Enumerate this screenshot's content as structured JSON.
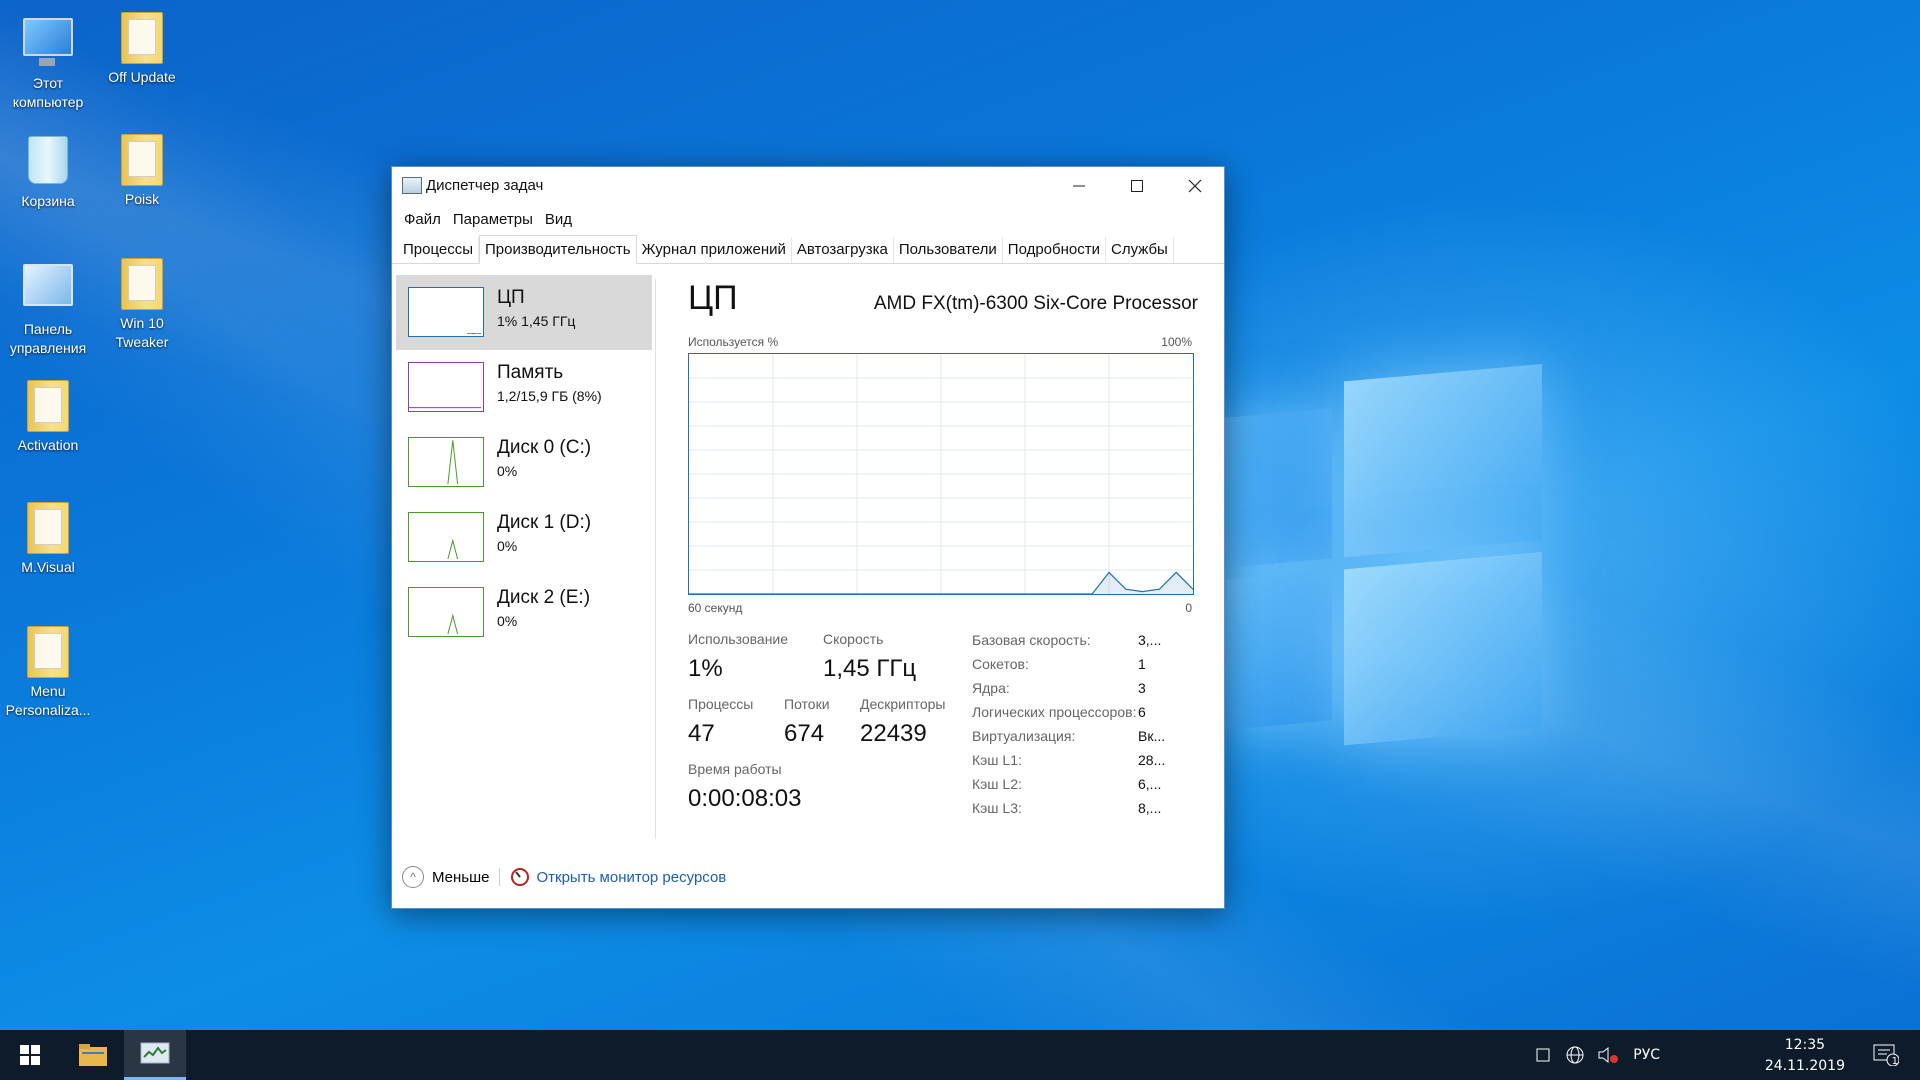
{
  "desktop": {
    "icons": [
      {
        "label": "Этот компьютер"
      },
      {
        "label": "Off Update"
      },
      {
        "label": "Корзина"
      },
      {
        "label": "Poisk"
      },
      {
        "label": "Панель управления"
      },
      {
        "label": "Win 10 Tweaker"
      },
      {
        "label": "Activation"
      },
      {
        "label": "M.Visual"
      },
      {
        "label": "Menu Personaliza..."
      }
    ]
  },
  "window": {
    "title": "Диспетчер задач",
    "menu": [
      "Файл",
      "Параметры",
      "Вид"
    ],
    "tabs": [
      "Процессы",
      "Производительность",
      "Журнал приложений",
      "Автозагрузка",
      "Пользователи",
      "Подробности",
      "Службы"
    ],
    "active_tab": "Производительность",
    "resources": [
      {
        "name": "ЦП",
        "value": "1% 1,45 ГГц",
        "color": "#1e6fb3"
      },
      {
        "name": "Память",
        "value": "1,2/15,9 ГБ (8%)",
        "color": "#8b3fa8"
      },
      {
        "name": "Диск 0 (C:)",
        "value": "0%",
        "color": "#4a9a2a"
      },
      {
        "name": "Диск 1 (D:)",
        "value": "0%",
        "color": "#4a9a2a"
      },
      {
        "name": "Диск 2 (E:)",
        "value": "0%",
        "color": "#4a9a2a"
      }
    ],
    "detail": {
      "title": "ЦП",
      "processor": "AMD FX(tm)-6300 Six-Core Processor",
      "chart_top_left": "Используется %",
      "chart_top_right": "100%",
      "chart_bottom_left": "60 секунд",
      "chart_bottom_right": "0",
      "usage_label": "Использование",
      "usage_value": "1%",
      "speed_label": "Скорость",
      "speed_value": "1,45 ГГц",
      "processes_label": "Процессы",
      "processes_value": "47",
      "threads_label": "Потоки",
      "threads_value": "674",
      "handles_label": "Дескрипторы",
      "handles_value": "22439",
      "uptime_label": "Время работы",
      "uptime_value": "0:00:08:03",
      "specs": [
        {
          "k": "Базовая скорость:",
          "v": "3,..."
        },
        {
          "k": "Сокетов:",
          "v": "1"
        },
        {
          "k": "Ядра:",
          "v": "3"
        },
        {
          "k": "Логических процессоров:",
          "v": "6"
        },
        {
          "k": "Виртуализация:",
          "v": "Вк..."
        },
        {
          "k": "Кэш L1:",
          "v": "28..."
        },
        {
          "k": "Кэш L2:",
          "v": "6,..."
        },
        {
          "k": "Кэш L3:",
          "v": "8,..."
        }
      ]
    },
    "footer": {
      "less": "Меньше",
      "monitor": "Открыть монитор ресурсов"
    }
  },
  "chart_data": {
    "type": "area",
    "x_seconds_ago": [
      60,
      12,
      10,
      8,
      6,
      4,
      2,
      0
    ],
    "y_percent": [
      0,
      0,
      9,
      2,
      1,
      2,
      9,
      2
    ],
    "ylim": [
      0,
      100
    ],
    "color": "#1e6fb3"
  },
  "taskbar": {
    "language": "РУС",
    "time": "12:35",
    "date": "24.11.2019",
    "notifications": "1"
  }
}
